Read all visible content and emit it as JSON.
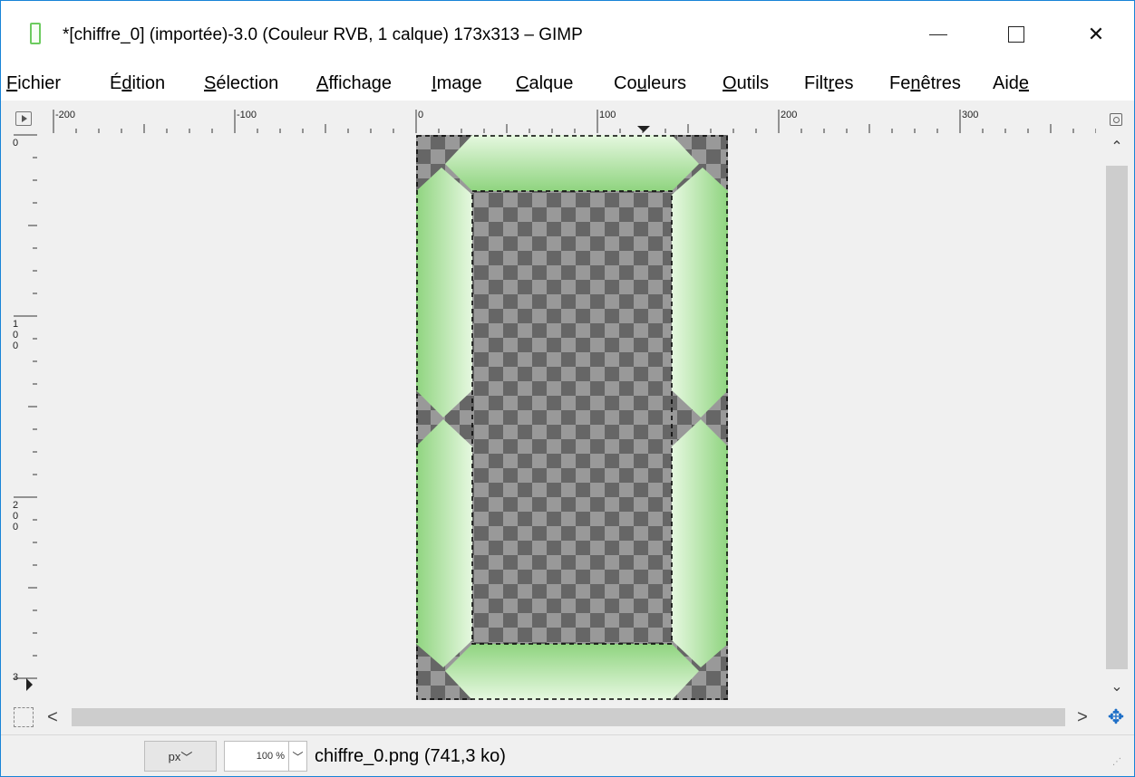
{
  "window": {
    "title": "*[chiffre_0] (importée)-3.0 (Couleur RVB, 1 calque) 173x313 – GIMP",
    "app_icon": "gimp-icon",
    "controls": {
      "minimize_icon": "minimize-icon",
      "maximize_icon": "maximize-icon",
      "close_icon": "close-icon",
      "close_glyph": "✕"
    }
  },
  "menubar": {
    "items": [
      {
        "label": "Fichier",
        "mnemonic": "F"
      },
      {
        "label": "Édition",
        "mnemonic": "d"
      },
      {
        "label": "Sélection",
        "mnemonic": "S"
      },
      {
        "label": "Affichage",
        "mnemonic": "A"
      },
      {
        "label": "Image",
        "mnemonic": "I"
      },
      {
        "label": "Calque",
        "mnemonic": "C"
      },
      {
        "label": "Couleurs",
        "mnemonic": "u"
      },
      {
        "label": "Outils",
        "mnemonic": "O"
      },
      {
        "label": "Filtres",
        "mnemonic": "r"
      },
      {
        "label": "Fenêtres",
        "mnemonic": "n"
      },
      {
        "label": "Aide",
        "mnemonic": "e"
      }
    ]
  },
  "rulers": {
    "horizontal_labels": [
      "-200",
      "-100",
      "0",
      "100",
      "200",
      "300"
    ],
    "vertical_labels": [
      "0",
      "100",
      "200",
      "3"
    ]
  },
  "canvas": {
    "image_name": "chiffre_0",
    "layers": 1,
    "size": "173x313",
    "colors": {
      "segment_light": "#dff5d8",
      "segment_dark": "#8fd47f",
      "checker_dark": "#666666",
      "checker_light": "#999999",
      "canvas_bg": "#f0f0f0"
    }
  },
  "scrollbars": {
    "up_icon": "▲",
    "down_icon": "▼",
    "left_icon": "‹",
    "right_icon": "›",
    "up_glyph": "⌃",
    "down_glyph": "⌄",
    "left_glyph": "<",
    "right_glyph": ">"
  },
  "navigation": {
    "icon": "navigate-icon",
    "glyph": "✥"
  },
  "statusbar": {
    "unit": "px",
    "unit_chevron": "﹀",
    "zoom": "100 %",
    "zoom_chevron": "﹀",
    "file_info": "chiffre_0.png (741,3 ko)"
  }
}
